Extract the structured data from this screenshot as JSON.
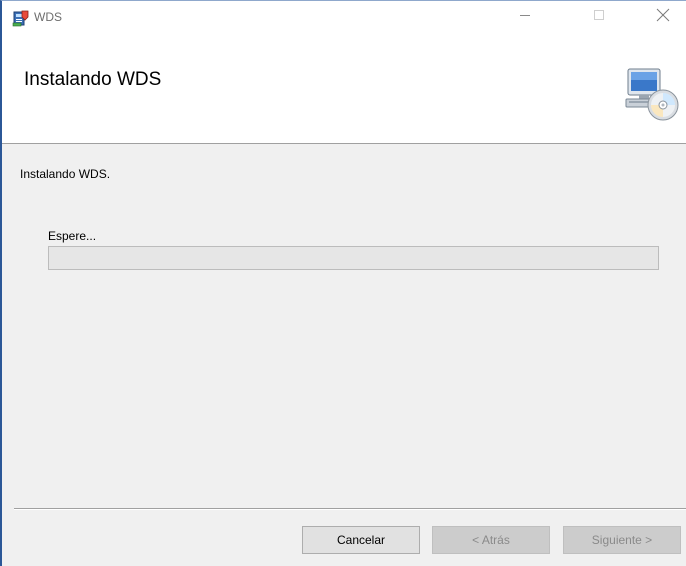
{
  "window": {
    "title": "WDS",
    "icons": {
      "app": "installer-package-icon",
      "minimize": "minimize-icon",
      "maximize": "maximize-icon",
      "close": "close-icon",
      "banner": "computer-cd-icon"
    }
  },
  "banner": {
    "title": "Instalando WDS"
  },
  "body": {
    "message": "Instalando WDS.",
    "wait_label": "Espere...",
    "progress": 0
  },
  "footer": {
    "cancel_label": "Cancelar",
    "back_label": "< Atrás",
    "next_label": "Siguiente >"
  },
  "colors": {
    "title_text": "#6d6d6d",
    "disabled_text": "#8a8a8a",
    "progress_track": "#e6e6e6",
    "window_border": "#2b5797"
  }
}
